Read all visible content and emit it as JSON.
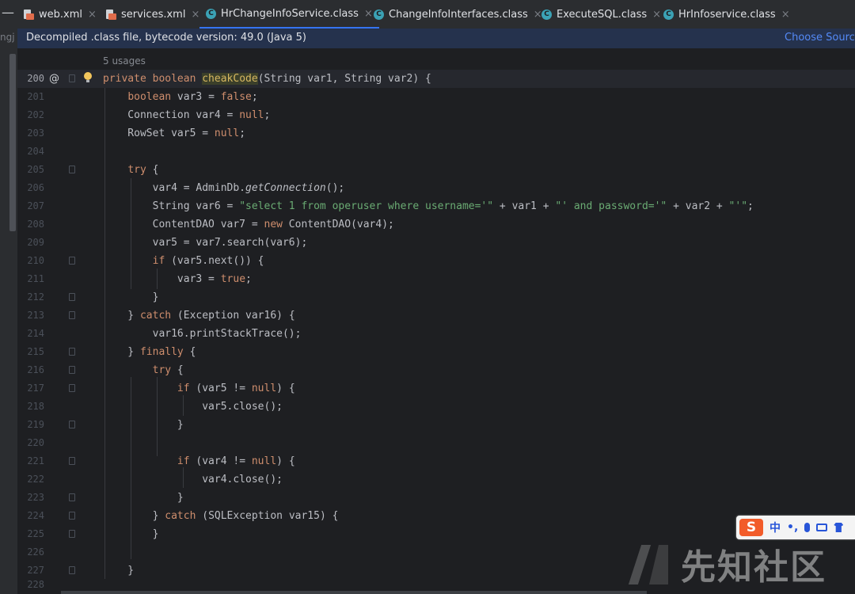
{
  "tabs": [
    {
      "label": "web.xml",
      "icon": "xml-file-icon",
      "active": false
    },
    {
      "label": "services.xml",
      "icon": "xml-file-icon",
      "active": false
    },
    {
      "label": "HrChangeInfoService.class",
      "icon": "class-file-icon",
      "active": true
    },
    {
      "label": "ChangeInfoInterfaces.class",
      "icon": "class-file-icon",
      "active": false
    },
    {
      "label": "ExecuteSQL.class",
      "icon": "class-file-icon",
      "active": false
    },
    {
      "label": "HrInfoservice.class",
      "icon": "class-file-icon",
      "active": false
    }
  ],
  "tab_close_glyph": "×",
  "left_strip": {
    "label": "ngj"
  },
  "banner": {
    "message": "Decompiled .class file, bytecode version: 49.0 (Java 5)",
    "action": "Choose Source"
  },
  "editor": {
    "usages": "5 usages",
    "current_line": 200,
    "at_marker": "@",
    "lines": [
      {
        "num": "200"
      },
      {
        "num": "201"
      },
      {
        "num": "202"
      },
      {
        "num": "203"
      },
      {
        "num": "204"
      },
      {
        "num": "205"
      },
      {
        "num": "206"
      },
      {
        "num": "207"
      },
      {
        "num": "208"
      },
      {
        "num": "209"
      },
      {
        "num": "210"
      },
      {
        "num": "211"
      },
      {
        "num": "212"
      },
      {
        "num": "213"
      },
      {
        "num": "214"
      },
      {
        "num": "215"
      },
      {
        "num": "216"
      },
      {
        "num": "217"
      },
      {
        "num": "218"
      },
      {
        "num": "219"
      },
      {
        "num": "220"
      },
      {
        "num": "221"
      },
      {
        "num": "222"
      },
      {
        "num": "223"
      },
      {
        "num": "224"
      },
      {
        "num": "225"
      },
      {
        "num": "226"
      },
      {
        "num": "227"
      },
      {
        "num": "228"
      }
    ]
  },
  "ime": {
    "logo": "S",
    "mode": "中",
    "punct": "•,"
  },
  "watermark": {
    "text": "先知社区"
  },
  "colors": {
    "keyword": "#cf8e6d",
    "string": "#6aab73",
    "method": "#56a8f5",
    "text": "#bcbec4",
    "accent": "#3574f0"
  }
}
